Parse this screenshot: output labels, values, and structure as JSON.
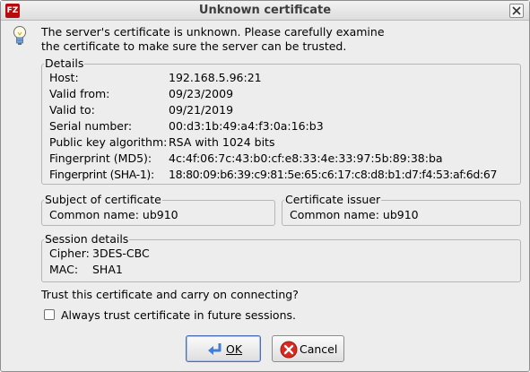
{
  "window": {
    "title": "Unknown certificate",
    "app_icon_text": "FZ"
  },
  "intro": {
    "line1": "The server's certificate is unknown. Please carefully examine",
    "line2": "the certificate to make sure the server can be trusted."
  },
  "details": {
    "legend": "Details",
    "rows": [
      {
        "label": "Host:",
        "value": "192.168.5.96:21"
      },
      {
        "label": "Valid from:",
        "value": "09/23/2009"
      },
      {
        "label": "Valid to:",
        "value": "09/21/2019"
      },
      {
        "label": "Serial number:",
        "value": "00:d3:1b:49:a4:f3:0a:16:b3"
      },
      {
        "label": "Public key algorithm:",
        "value": "RSA with 1024 bits"
      },
      {
        "label": "Fingerprint (MD5):",
        "value": "4c:4f:06:7c:43:b0:cf:e8:33:4e:33:97:5b:89:38:ba"
      },
      {
        "label": "Fingerprint (SHA-1):",
        "value": "18:80:09:b6:39:c9:81:5e:65:c6:17:c8:d8:b1:d7:f4:53:af:6d:67"
      }
    ]
  },
  "subject": {
    "legend": "Subject of certificate",
    "text": "Common name: ub910"
  },
  "issuer": {
    "legend": "Certificate issuer",
    "text": "Common name: ub910"
  },
  "session": {
    "legend": "Session details",
    "cipher_label": "Cipher:",
    "cipher_value": "3DES-CBC",
    "mac_label": "MAC:",
    "mac_value": "SHA1"
  },
  "trust_question": "Trust this certificate and carry on connecting?",
  "always_trust": {
    "label": "Always trust certificate in future sessions.",
    "checked": false
  },
  "buttons": {
    "ok": "OK",
    "cancel": "Cancel"
  },
  "icons": {
    "app": "filezilla-icon",
    "info": "lightbulb-icon",
    "ok": "return-arrow-icon",
    "cancel": "cancel-icon"
  },
  "colors": {
    "app_icon": "#b80c0c",
    "cancel_icon": "#d8281f",
    "ok_icon": "#3f7fd6"
  }
}
